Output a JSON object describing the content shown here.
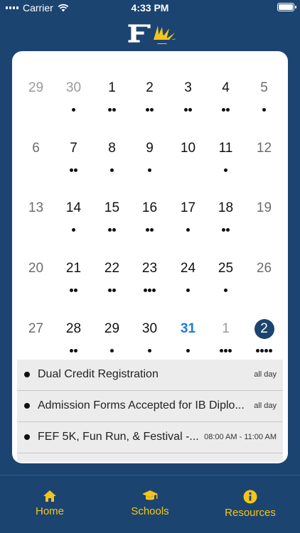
{
  "status_bar": {
    "carrier": "Carrier",
    "time": "4:33 PM"
  },
  "calendar": {
    "weeks": [
      [
        {
          "day": "29",
          "dots": 0,
          "kind": "other"
        },
        {
          "day": "30",
          "dots": 1,
          "kind": "other"
        },
        {
          "day": "1",
          "dots": 2,
          "kind": "normal"
        },
        {
          "day": "2",
          "dots": 2,
          "kind": "normal"
        },
        {
          "day": "3",
          "dots": 2,
          "kind": "normal"
        },
        {
          "day": "4",
          "dots": 2,
          "kind": "normal"
        },
        {
          "day": "5",
          "dots": 1,
          "kind": "weekend"
        }
      ],
      [
        {
          "day": "6",
          "dots": 0,
          "kind": "weekend"
        },
        {
          "day": "7",
          "dots": 2,
          "kind": "normal"
        },
        {
          "day": "8",
          "dots": 1,
          "kind": "normal"
        },
        {
          "day": "9",
          "dots": 1,
          "kind": "normal"
        },
        {
          "day": "10",
          "dots": 0,
          "kind": "normal"
        },
        {
          "day": "11",
          "dots": 1,
          "kind": "normal"
        },
        {
          "day": "12",
          "dots": 0,
          "kind": "weekend"
        }
      ],
      [
        {
          "day": "13",
          "dots": 0,
          "kind": "weekend"
        },
        {
          "day": "14",
          "dots": 1,
          "kind": "normal"
        },
        {
          "day": "15",
          "dots": 2,
          "kind": "normal"
        },
        {
          "day": "16",
          "dots": 2,
          "kind": "normal"
        },
        {
          "day": "17",
          "dots": 1,
          "kind": "normal"
        },
        {
          "day": "18",
          "dots": 2,
          "kind": "normal"
        },
        {
          "day": "19",
          "dots": 0,
          "kind": "weekend"
        }
      ],
      [
        {
          "day": "20",
          "dots": 0,
          "kind": "weekend"
        },
        {
          "day": "21",
          "dots": 2,
          "kind": "normal"
        },
        {
          "day": "22",
          "dots": 2,
          "kind": "normal"
        },
        {
          "day": "23",
          "dots": 3,
          "kind": "normal"
        },
        {
          "day": "24",
          "dots": 1,
          "kind": "normal"
        },
        {
          "day": "25",
          "dots": 1,
          "kind": "normal"
        },
        {
          "day": "26",
          "dots": 0,
          "kind": "weekend"
        }
      ],
      [
        {
          "day": "27",
          "dots": 0,
          "kind": "weekend"
        },
        {
          "day": "28",
          "dots": 2,
          "kind": "normal"
        },
        {
          "day": "29",
          "dots": 1,
          "kind": "normal"
        },
        {
          "day": "30",
          "dots": 1,
          "kind": "normal"
        },
        {
          "day": "31",
          "dots": 1,
          "kind": "today"
        },
        {
          "day": "1",
          "dots": 3,
          "kind": "other"
        },
        {
          "day": "2",
          "dots": 4,
          "kind": "selected"
        }
      ]
    ]
  },
  "events": [
    {
      "title": "Dual Credit Registration",
      "time": "all day"
    },
    {
      "title": "Admission Forms Accepted for IB Diplo...",
      "time": "all day"
    },
    {
      "title": "FEF 5K, Fun Run, & Festival -...",
      "time": "08:00 AM - 11:00 AM"
    }
  ],
  "tabs": [
    {
      "label": "Home",
      "icon": "home-icon"
    },
    {
      "label": "Schools",
      "icon": "graduation-cap-icon"
    },
    {
      "label": "Resources",
      "icon": "info-icon"
    }
  ],
  "colors": {
    "background": "#1c4470",
    "accent": "#f5c518",
    "today": "#1a7ce0",
    "selected": "#1c4470"
  }
}
